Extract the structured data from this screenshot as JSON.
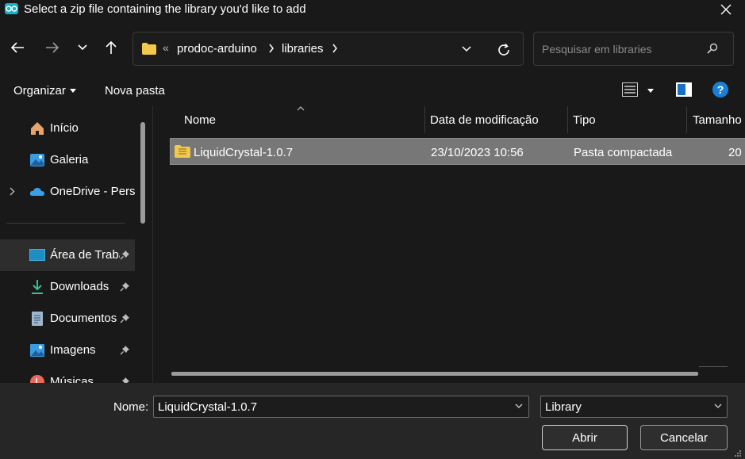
{
  "window": {
    "title": "Select a zip file containing the library you'd like to add",
    "app_icon": "arduino-icon"
  },
  "nav": {
    "back_icon": "arrow-left-icon",
    "forward_icon": "arrow-right-icon",
    "recent_icon": "chevron-down-icon",
    "up_icon": "arrow-up-icon",
    "breadcrumb_overflow": "«",
    "breadcrumb": [
      "prodoc-arduino",
      "libraries"
    ],
    "search_placeholder": "Pesquisar em libraries"
  },
  "toolbar": {
    "organize_label": "Organizar",
    "new_folder_label": "Nova pasta"
  },
  "sidebar": {
    "items": [
      {
        "label": "Início",
        "icon": "home-icon"
      },
      {
        "label": "Galeria",
        "icon": "gallery-icon"
      },
      {
        "label": "OneDrive - Personal",
        "icon": "onedrive-cloud-icon"
      },
      {
        "label": "Área de Trabalho",
        "icon": "desktop-icon",
        "pinned": true
      },
      {
        "label": "Downloads",
        "icon": "download-icon",
        "pinned": true
      },
      {
        "label": "Documentos",
        "icon": "documents-icon",
        "pinned": true
      },
      {
        "label": "Imagens",
        "icon": "images-icon",
        "pinned": true
      },
      {
        "label": "Músicas",
        "icon": "music-icon",
        "pinned": true
      }
    ]
  },
  "columns": [
    "Nome",
    "Data de modificação",
    "Tipo",
    "Tamanho"
  ],
  "files": [
    {
      "name": "LiquidCrystal-1.0.7",
      "modified": "23/10/2023 10:56",
      "type": "Pasta compactada",
      "size": "20",
      "icon": "zip-folder-icon"
    }
  ],
  "footer": {
    "name_label": "Nome:",
    "name_value": "LiquidCrystal-1.0.7",
    "filter_value": "Library",
    "open_label": "Abrir",
    "cancel_label": "Cancelar"
  },
  "colors": {
    "background": "#191919",
    "footer_bg": "#262626",
    "selected_row": "#777777",
    "help_blue": "#1a7fd9",
    "folder_yellow": "#f2c94c"
  }
}
